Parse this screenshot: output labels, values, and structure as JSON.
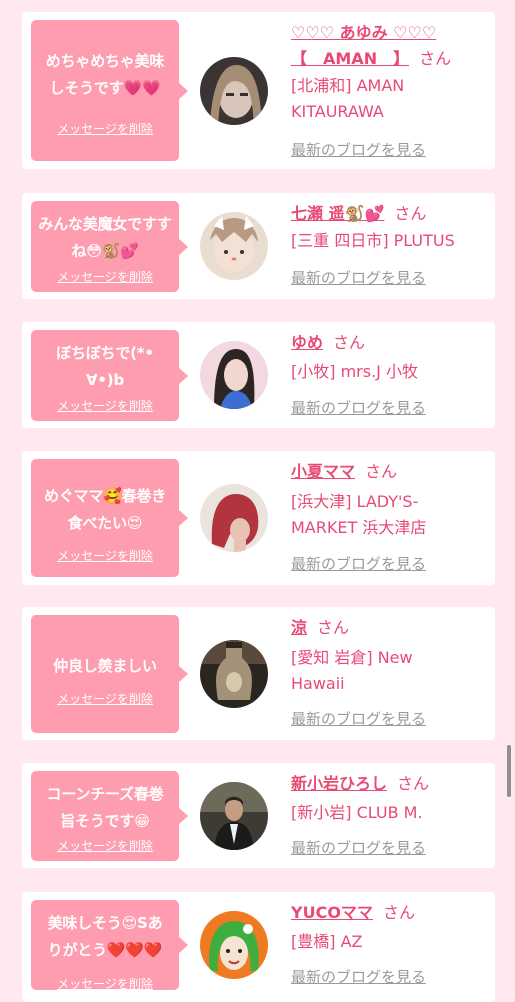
{
  "delete_label": "メッセージを削除",
  "blog_label": "最新のブログを見る",
  "honorific": "さん",
  "colors": {
    "page_background": "#ffe9ef",
    "bubble": "#ff9db0",
    "name_pink": "#e84a74",
    "link_gray": "#9a9a9a"
  },
  "entries": [
    {
      "message_lines": [
        "めちゃめちゃ美味",
        "しそうです💗💗"
      ],
      "name_lines": [
        "♡♡♡ あゆみ ♡♡♡",
        "【　AMAN　】"
      ],
      "store_lines": [
        "[北浦和] AMAN",
        "KITAURAWA"
      ],
      "avatar": "woman-selfie-avatar"
    },
    {
      "message_lines": [
        "みんな美魔女ですす",
        "ね😳🐒💕"
      ],
      "name_lines": [
        "七瀬 遥🐒💕"
      ],
      "store_lines": [
        "[三重 四日市] PLUTUS"
      ],
      "avatar": "girl-cat-filter-avatar"
    },
    {
      "message_lines": [
        "ぼちぼちで(*•",
        "∀•)b"
      ],
      "name_lines": [
        "ゆめ"
      ],
      "store_lines": [
        "[小牧] mrs.J 小牧"
      ],
      "avatar": "woman-portrait-avatar"
    },
    {
      "message_lines": [
        "めぐママ🥰春巻き",
        "食べたい😍"
      ],
      "name_lines": [
        "小夏ママ"
      ],
      "store_lines": [
        "[浜大津] LADY'S-",
        "MARKET 浜大津店"
      ],
      "avatar": "red-hair-avatar"
    },
    {
      "message_lines": [
        "仲良し羨ましい"
      ],
      "name_lines": [
        "涼"
      ],
      "store_lines": [
        "[愛知 岩倉] New",
        "Hawaii"
      ],
      "avatar": "bottle-avatar"
    },
    {
      "message_lines": [
        "コーンチーズ春巻",
        "旨そうです😁"
      ],
      "name_lines": [
        "新小岩ひろし"
      ],
      "store_lines": [
        "[新小岩] CLUB M."
      ],
      "avatar": "man-suit-avatar"
    },
    {
      "message_lines": [
        "美味しそう😍Sあ",
        "りがとう❤️❤️❤️"
      ],
      "name_lines": [
        "YUCOママ"
      ],
      "store_lines": [
        "[豊橋] AZ"
      ],
      "avatar": "green-hair-illustration-avatar"
    }
  ]
}
